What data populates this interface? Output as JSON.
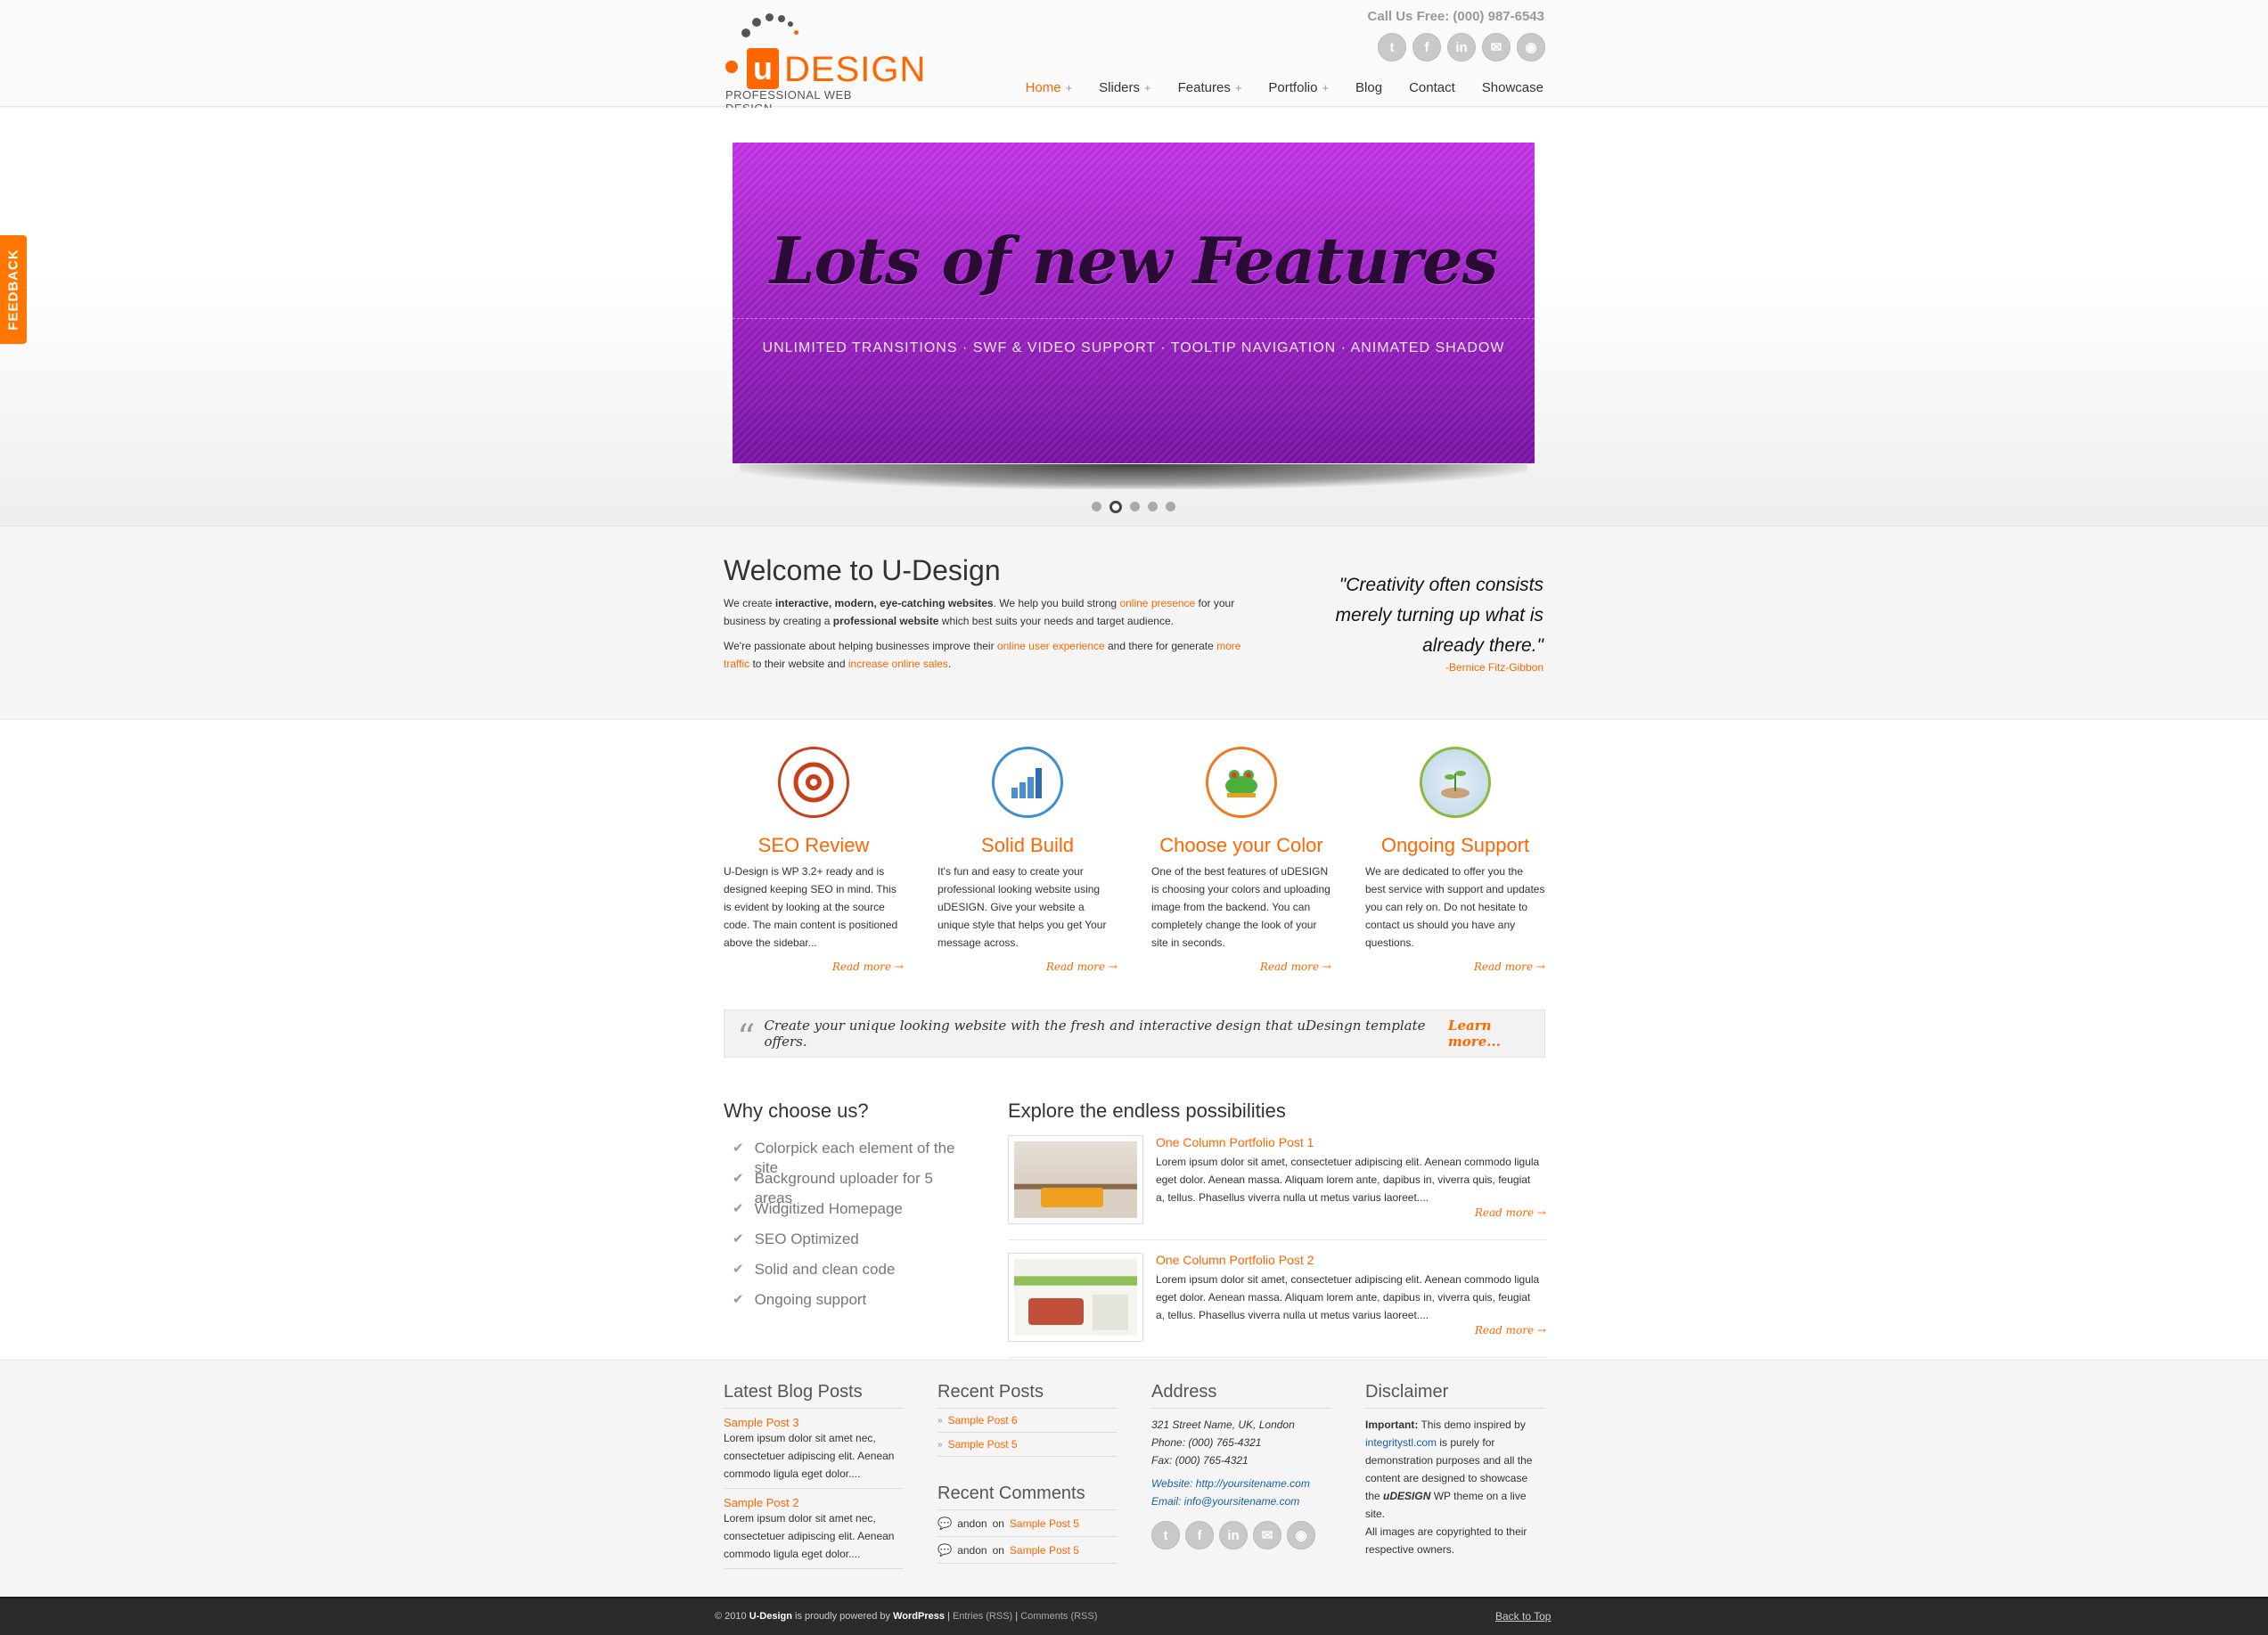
{
  "header": {
    "logo_u": "u",
    "logo_text": "DESIGN",
    "logo_tagline": "PROFESSIONAL WEB DESIGN",
    "call_us": "Call Us Free: (000) 987-6543",
    "social_icons": [
      "twitter-icon",
      "facebook-icon",
      "linkedin-icon",
      "email-icon",
      "rss-icon"
    ],
    "nav": [
      {
        "label": "Home",
        "has_sub": "+"
      },
      {
        "label": "Sliders",
        "has_sub": "+"
      },
      {
        "label": "Features",
        "has_sub": "+"
      },
      {
        "label": "Portfolio",
        "has_sub": "+"
      },
      {
        "label": "Blog",
        "has_sub": ""
      },
      {
        "label": "Contact",
        "has_sub": ""
      },
      {
        "label": "Showcase",
        "has_sub": ""
      }
    ]
  },
  "feedback_tab": "FEEDBACK",
  "slider": {
    "title": "Lots of new Features",
    "subtitle": "UNLIMITED TRANSITIONS · SWF & VIDEO SUPPORT · TOOLTIP NAVIGATION · ANIMATED SHADOW",
    "slide_count": 5,
    "active_slide": 2
  },
  "welcome": {
    "heading": "Welcome to U-Design",
    "p1_a": "We create ",
    "p1_b": "interactive, modern, eye-catching websites",
    "p1_c": ". We help you build strong ",
    "p1_link": "online presence",
    "p1_d": " for your business by creating a ",
    "p1_e": "professional website",
    "p1_f": " which best suits your needs and target audience.",
    "p2_a": "We're passionate about helping businesses improve their ",
    "p2_link1": "online user experience",
    "p2_b": " and there for generate ",
    "p2_link2": "more traffic",
    "p2_c": " to their website and ",
    "p2_link3": "increase online sales",
    "p2_d": "."
  },
  "quote": {
    "text": "\"Creativity often consists merely turning up what is already there.\"",
    "author": "-Bernice Fitz-Gibbon"
  },
  "features": [
    {
      "title": "SEO Review",
      "text": "U-Design is WP 3.2+ ready and is designed keeping SEO in mind. This is evident by looking at the source code. The main content is positioned above the sidebar...",
      "more": "Read more →"
    },
    {
      "title": "Solid Build",
      "text": "It's fun and easy to create your professional looking website using uDESIGN. Give your website a unique style that helps you get Your message across.",
      "more": "Read more →"
    },
    {
      "title": "Choose your Color",
      "text": "One of the best features of uDESIGN is choosing your colors and uploading image from the backend. You can completely change the look of your site in seconds.",
      "more": "Read more →"
    },
    {
      "title": "Ongoing Support",
      "text": "We are dedicated to offer you the best service with support and updates you can rely on. Do not hesitate to contact us should you have any questions.",
      "more": "Read more →"
    }
  ],
  "callout": {
    "quote_mark": "“",
    "text": "Create your unique looking website with the fresh and interactive design that uDesingn template offers.",
    "link": "Learn more..."
  },
  "why": {
    "heading": "Why choose us?",
    "items": [
      "Colorpick each element of the site",
      "Background uploader for 5 areas",
      "Widgitized Homepage",
      "SEO Optimized",
      "Solid and clean code",
      "Ongoing support"
    ]
  },
  "explore": {
    "heading": "Explore the endless possibilities",
    "posts": [
      {
        "title": "One Column Portfolio Post 1",
        "text": "Lorem ipsum dolor sit amet, consectetuer adipiscing elit. Aenean commodo ligula eget dolor. Aenean massa. Aliquam lorem ante, dapibus in, viverra quis, feugiat a, tellus. Phasellus viverra nulla ut metus varius laoreet....",
        "more": "Read more →"
      },
      {
        "title": "One Column Portfolio Post 2",
        "text": "Lorem ipsum dolor sit amet, consectetuer adipiscing elit. Aenean commodo ligula eget dolor. Aenean massa. Aliquam lorem ante, dapibus in, viverra quis, feugiat a, tellus. Phasellus viverra nulla ut metus varius laoreet....",
        "more": "Read more →"
      }
    ]
  },
  "footer": {
    "latest_blog": {
      "heading": "Latest Blog Posts",
      "posts": [
        {
          "title": "Sample Post 3",
          "text": "Lorem ipsum dolor sit amet nec, consectetuer adipiscing elit. Aenean commodo ligula eget dolor...."
        },
        {
          "title": "Sample Post 2",
          "text": "Lorem ipsum dolor sit amet nec, consectetuer adipiscing elit. Aenean commodo ligula eget dolor...."
        }
      ]
    },
    "recent_posts": {
      "heading": "Recent Posts",
      "items": [
        "Sample Post 6",
        "Sample Post 5"
      ]
    },
    "recent_comments": {
      "heading": "Recent Comments",
      "items": [
        {
          "author": "andon",
          "on": " on ",
          "post": "Sample Post 5"
        },
        {
          "author": "andon",
          "on": " on ",
          "post": "Sample Post 5"
        }
      ]
    },
    "address": {
      "heading": "Address",
      "street": "321 Street Name, UK, London",
      "phone": "Phone: (000) 765-4321",
      "fax": "Fax: (000) 765-4321",
      "website": "Website: http://yoursitename.com",
      "email": "Email: info@yoursitename.com"
    },
    "disclaimer": {
      "heading": "Disclaimer",
      "important": "Important:",
      "t1": " This demo inspired by ",
      "link": "integritystl.com",
      "t2": " is purely for demonstration purposes and all the content are designed to showcase the ",
      "udesign": "uDESIGN",
      "t3": " WP theme on a live site.",
      "t4": "All images are copyrighted to their respective owners."
    }
  },
  "bottombar": {
    "copy_a": "© 2010 ",
    "copy_b": "U-Design",
    "copy_c": " is proudly powered by ",
    "copy_d": "WordPress",
    "sep": " | ",
    "entries": "Entries (RSS)",
    "comments": "Comments (RSS)",
    "back_to_top": "Back to Top"
  },
  "colors": {
    "accent": "#ff6600",
    "slide_top": "#c534e8",
    "slide_bottom": "#7a14a6",
    "footer_bar": "#2b2b2b"
  }
}
